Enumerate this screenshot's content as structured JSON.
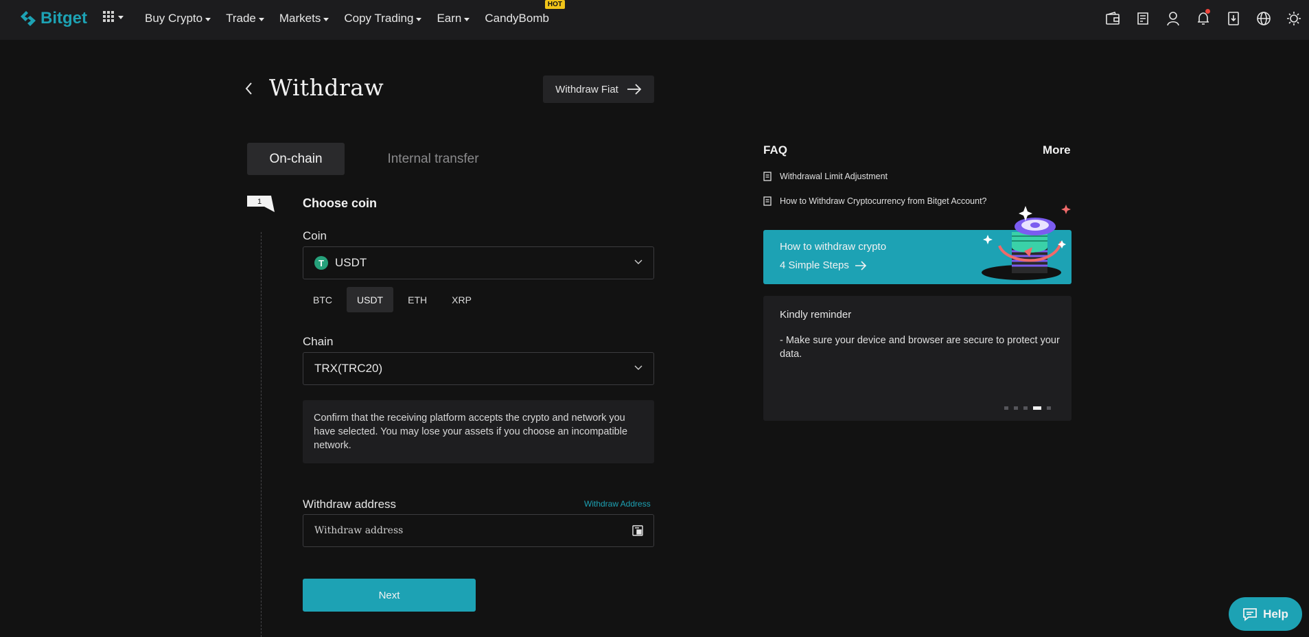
{
  "brand": {
    "name": "Bitget",
    "accent": "#1da2b4"
  },
  "nav": {
    "items": [
      {
        "label": "Buy Crypto"
      },
      {
        "label": "Trade"
      },
      {
        "label": "Markets"
      },
      {
        "label": "Copy Trading"
      },
      {
        "label": "Earn"
      },
      {
        "label": "CandyBomb",
        "badge": "HOT"
      }
    ],
    "icons": [
      "wallet-icon",
      "orders-icon",
      "user-icon",
      "bell-icon",
      "download-icon",
      "globe-icon",
      "theme-icon"
    ]
  },
  "page": {
    "title": "Withdraw",
    "fiat_button": "Withdraw Fiat"
  },
  "tabs": [
    {
      "label": "On-chain",
      "active": true
    },
    {
      "label": "Internal transfer",
      "active": false
    }
  ],
  "step": {
    "number": "1",
    "title": "Choose coin"
  },
  "coin": {
    "label": "Coin",
    "selected": "USDT",
    "quick": [
      "BTC",
      "USDT",
      "ETH",
      "XRP"
    ]
  },
  "chain": {
    "label": "Chain",
    "selected": "TRX(TRC20)"
  },
  "notice": "Confirm that the receiving platform accepts the crypto and network you have selected. You may lose your assets if you choose an incompatible network.",
  "address": {
    "label": "Withdraw address",
    "link": "Withdraw Address",
    "placeholder": "Withdraw address"
  },
  "next_button": "Next",
  "faq": {
    "title": "FAQ",
    "more": "More",
    "items": [
      "Withdrawal Limit Adjustment",
      "How to Withdraw Cryptocurrency from Bitget Account?"
    ]
  },
  "promo": {
    "title": "How to withdraw crypto",
    "subtitle": "4 Simple Steps"
  },
  "reminder": {
    "title": "Kindly reminder",
    "body": "- Make sure your device and browser are secure to protect your data.",
    "slides": 5,
    "active_slide": 4
  },
  "help": "Help"
}
